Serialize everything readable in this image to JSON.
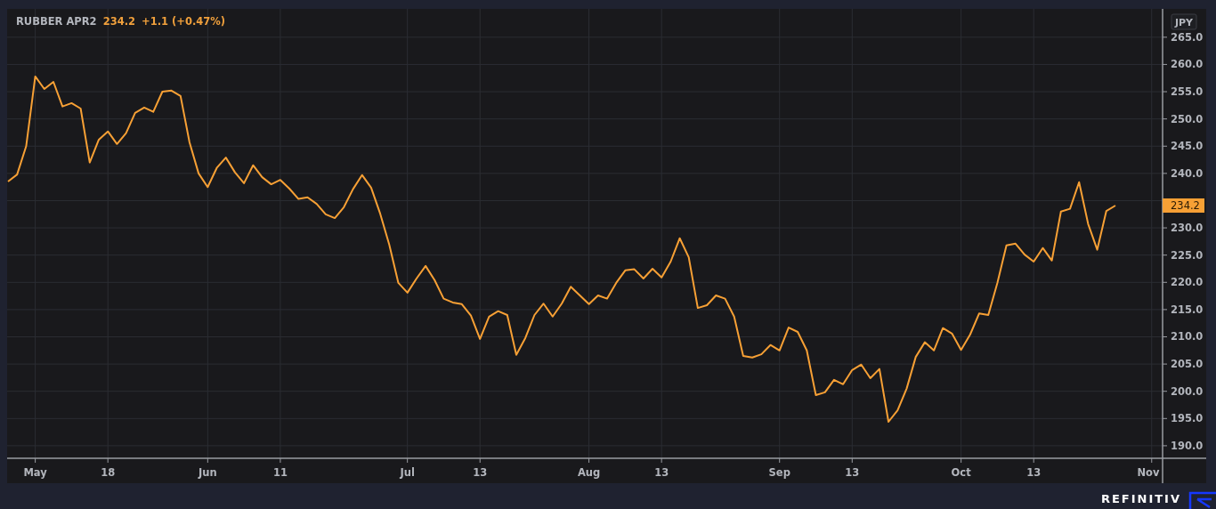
{
  "header": {
    "price": "234.2",
    "change": "+1.1 (+0.47%)"
  },
  "chart": {
    "currency": "JPY",
    "last_price_label": "234.2",
    "chart_data": {
      "type": "line",
      "grid": true,
      "ylim": [
        187.7,
        270.2
      ],
      "categories": [
        null,
        null,
        null,
        "May",
        null,
        null,
        null,
        null,
        null,
        null,
        null,
        "18",
        null,
        null,
        null,
        null,
        null,
        null,
        null,
        null,
        null,
        null,
        "Jun",
        null,
        null,
        null,
        null,
        null,
        null,
        null,
        "11",
        null,
        null,
        null,
        null,
        null,
        null,
        null,
        null,
        null,
        null,
        null,
        null,
        null,
        "Jul",
        null,
        null,
        null,
        null,
        null,
        null,
        null,
        "13",
        null,
        null,
        null,
        null,
        null,
        null,
        null,
        null,
        null,
        null,
        null,
        "Aug",
        null,
        null,
        null,
        null,
        null,
        null,
        null,
        "13",
        null,
        null,
        null,
        null,
        null,
        null,
        null,
        null,
        null,
        null,
        null,
        null,
        "Sep",
        null,
        null,
        null,
        null,
        null,
        null,
        null,
        "13",
        null,
        null,
        null,
        null,
        null,
        null,
        null,
        null,
        null,
        null,
        null,
        "Oct",
        null,
        null,
        null,
        null,
        null,
        null,
        null,
        "13",
        null,
        null,
        null,
        null,
        null,
        null,
        null,
        null,
        null,
        null,
        null,
        null,
        "Nov",
        null
      ],
      "yticks": [
        {
          "value": 190,
          "label": "190.0"
        },
        {
          "value": 195,
          "label": "195.0"
        },
        {
          "value": 200,
          "label": "200.0"
        },
        {
          "value": 205,
          "label": "205.0"
        },
        {
          "value": 210,
          "label": "210.0"
        },
        {
          "value": 215,
          "label": "215.0"
        },
        {
          "value": 220,
          "label": "220.0"
        },
        {
          "value": 225,
          "label": "225.0"
        },
        {
          "value": 230,
          "label": "230.0"
        },
        {
          "value": 240,
          "label": "240.0"
        },
        {
          "value": 245,
          "label": "245.0"
        },
        {
          "value": 250,
          "label": "250.0"
        },
        {
          "value": 255,
          "label": "255.0"
        },
        {
          "value": 260,
          "label": "260.0"
        },
        {
          "value": 265,
          "label": "265.0"
        }
      ],
      "series": [
        {
          "name": "RUBBER APR2",
          "color": "#f7a035",
          "values": [
            238.5,
            239.8,
            245,
            257.8,
            255.5,
            256.8,
            252.3,
            252.9,
            251.9,
            242,
            246.2,
            247.7,
            245.4,
            247.4,
            251.1,
            252.1,
            251.3,
            255,
            255.2,
            254.2,
            245.7,
            240,
            237.5,
            241,
            242.9,
            240.2,
            238.2,
            241.5,
            239.3,
            238,
            238.8,
            237.2,
            235.3,
            235.6,
            234.4,
            232.5,
            231.8,
            233.8,
            237.1,
            239.7,
            237.4,
            232.6,
            226.9,
            219.9,
            218.1,
            220.7,
            223,
            220.4,
            217,
            216.3,
            216,
            213.9,
            209.6,
            213.7,
            214.7,
            214,
            206.7,
            209.8,
            214,
            216.1,
            213.7,
            216.1,
            219.2,
            217.6,
            216,
            217.6,
            217,
            219.9,
            222.2,
            222.4,
            220.7,
            222.5,
            220.9,
            223.8,
            228.1,
            224.6,
            215.3,
            215.8,
            217.6,
            217,
            213.7,
            206.5,
            206.2,
            206.8,
            208.5,
            207.5,
            211.7,
            210.9,
            207.5,
            199.3,
            199.8,
            202.1,
            201.3,
            203.9,
            204.9,
            202.4,
            204.1,
            194.4,
            196.5,
            200.5,
            206.3,
            209,
            207.5,
            211.6,
            210.6,
            207.6,
            210.4,
            214.3,
            214,
            219.9,
            226.8,
            227.1,
            225.1,
            223.8,
            226.3,
            224,
            233,
            233.5,
            238.4,
            230.7,
            226,
            233.1,
            234.1,
            null,
            null,
            null,
            null,
            null
          ]
        }
      ]
    }
  },
  "footer": {
    "brand": "REFINITIV"
  }
}
